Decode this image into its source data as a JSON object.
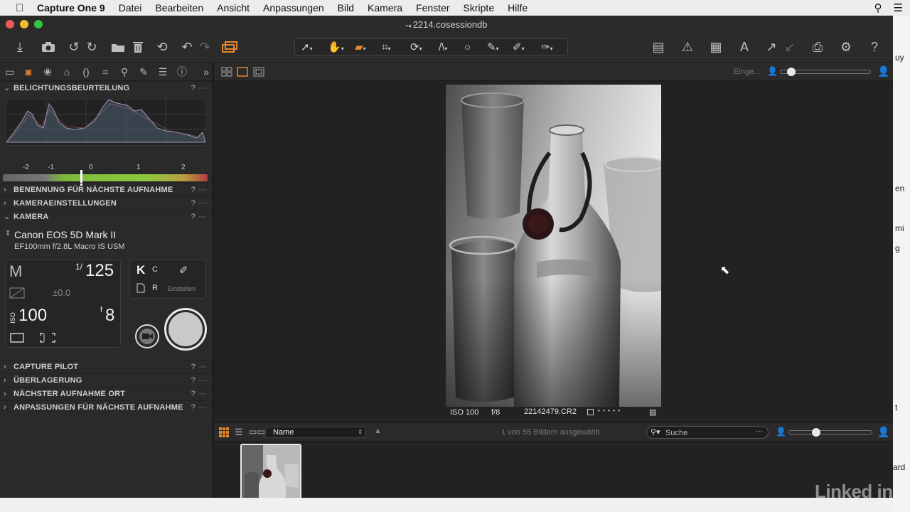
{
  "menubar": {
    "app": "Capture One 9",
    "items": [
      "Datei",
      "Bearbeiten",
      "Ansicht",
      "Anpassungen",
      "Bild",
      "Kamera",
      "Fenster",
      "Skripte",
      "Hilfe"
    ]
  },
  "window": {
    "title": "2214.cosessiondb"
  },
  "left_panel": {
    "sections_top": [
      "BELICHTUNGSBEURTEILUNG"
    ],
    "ev_labels": [
      "-2",
      "-1",
      "0",
      "1",
      "2"
    ],
    "sections_mid": [
      "BENENNUNG FÜR NÄCHSTE AUFNAHME",
      "KAMERAEINSTELLUNGEN",
      "KAMERA"
    ],
    "camera": {
      "name": "Canon EOS 5D Mark II",
      "lens": "EF100mm f/2.8L Macro IS USM",
      "mode": "M",
      "shutter_prefix": "1/",
      "shutter": "125",
      "exp_comp": "±0.0",
      "iso_label": "ISO",
      "iso": "100",
      "aperture_prefix": "f",
      "aperture": "8",
      "k_label": "K",
      "c_label": "C",
      "r_label": "R",
      "einstellen": "Einstellen"
    },
    "sections_bottom": [
      "CAPTURE PILOT",
      "ÜBERLAGERUNG",
      "NÄCHSTER AUFNAHME ORT",
      "ANPASSUNGEN FÜR NÄCHSTE AUFNAHME"
    ],
    "help": "?",
    "more": "···"
  },
  "viewer": {
    "zoom_label": "Einge...",
    "zoom_level": 0.08,
    "info": {
      "iso": "ISO 100",
      "aperture": "f/8",
      "filename": "22142479.CR2",
      "rating": "• • • • •"
    }
  },
  "browser": {
    "sort_label": "Name",
    "count_text": "1 von 55 Bildern ausgewählt",
    "search_placeholder": "Suche",
    "thumb_size": 0.3
  },
  "rightstrip": {
    "fragments": [
      "uy",
      "en",
      "mi",
      "g",
      "t",
      "ard"
    ]
  },
  "watermark": "Linked in"
}
